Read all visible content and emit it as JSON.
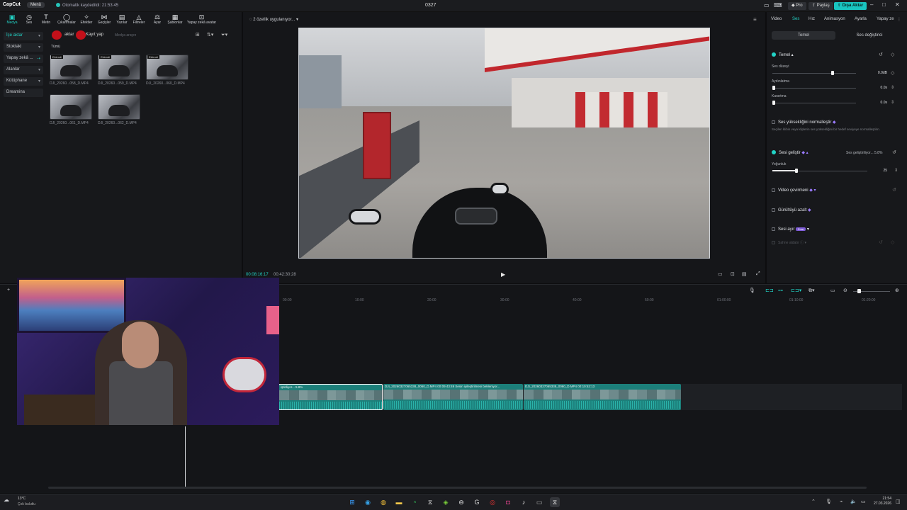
{
  "titlebar": {
    "logo": "CapCut",
    "menu": "Menü",
    "autosave": "Otomatik kaydedildi: 21:53:45",
    "project": "0327",
    "pro": "Pro",
    "share": "Paylaş",
    "export": "Dışa Aktar"
  },
  "toolbar": {
    "items": [
      "Medya",
      "Ses",
      "Metin",
      "Çıkartmalar",
      "Efektler",
      "Geçişler",
      "Yazılar",
      "Filtreler",
      "Ayar",
      "Şablonlar",
      "Yapay zekâ avatar"
    ]
  },
  "sidenav": {
    "items": [
      "İçe aktar",
      "Stoktaki",
      "Yapay zekâ ...",
      "Alanlar",
      "Kütüphane",
      "Dreamina"
    ]
  },
  "media": {
    "import_btn": "aktar",
    "record_btn": "Kayıt yap",
    "search_placeholder": "Medya arayın",
    "filter_all": "Tümü",
    "badge": "Eklendi",
    "clips": [
      "DJI_20260...058_D.MP4",
      "DJI_20260...059_D.MP4",
      "DJI_20260...060_D.MP4",
      "DJI_20260...061_D.MP4",
      "DJI_20260...062_D.MP4"
    ]
  },
  "player": {
    "status": "2 özellik uygulanıyor...",
    "time_current": "00:08:16:17",
    "time_total": "00:42:30:28"
  },
  "right": {
    "tabs": [
      "Video",
      "Ses",
      "Hız",
      "Animasyon",
      "Ayarla",
      "Yapay ze"
    ],
    "subtabs": [
      "Temel",
      "Ses değiştirici"
    ],
    "basic": "Temel",
    "volume_label": "Ses düzeyi",
    "volume_value": "0.0dB",
    "volume_level": 0.7,
    "fadein_label": "Aydınlatma",
    "fadein_value": "0.0s",
    "fadeout_label": "Karartma",
    "fadeout_value": "0.0s",
    "normalize_label": "Ses yüksekliğini normalleştir",
    "normalize_desc": "Seçilen klibin veya kliplerin ses yüksekliğini bir hedef seviyeye normalleştirin.",
    "enhance_label": "Sesi geliştir",
    "enhance_status": "Ses geliştiriliyor... 5.8%",
    "intensity_label": "Yoğunluk",
    "intensity_value": "25",
    "intensity_level": 0.25,
    "voice_convert": "Video çevirmeni",
    "noise_reduce": "Gürültüyü azalt",
    "separate": "Sesi ayır",
    "separate_badge": "Free",
    "dimmed_label": "Sahne aldatır"
  },
  "timeline": {
    "ruler": [
      "00:00",
      "10:00",
      "20:00",
      "30:00",
      "40:00",
      "50:00",
      "01:00:00",
      "01:10:00",
      "01:20:00"
    ],
    "clips": [
      {
        "label": "iştiriliyor... 5.8%"
      },
      {
        "label": "DJI_20260327065338_0060_D.MP4   00:09:43:49   Sesin iyileştirilmesi bekleniyor..."
      },
      {
        "label": "DJI_20260327065338_0060_D.MP4   00:10:52:13"
      }
    ]
  },
  "taskbar": {
    "temp": "13°C",
    "weather": "Çok bulutlu",
    "time": "21:54",
    "date": "27.03.2026"
  }
}
